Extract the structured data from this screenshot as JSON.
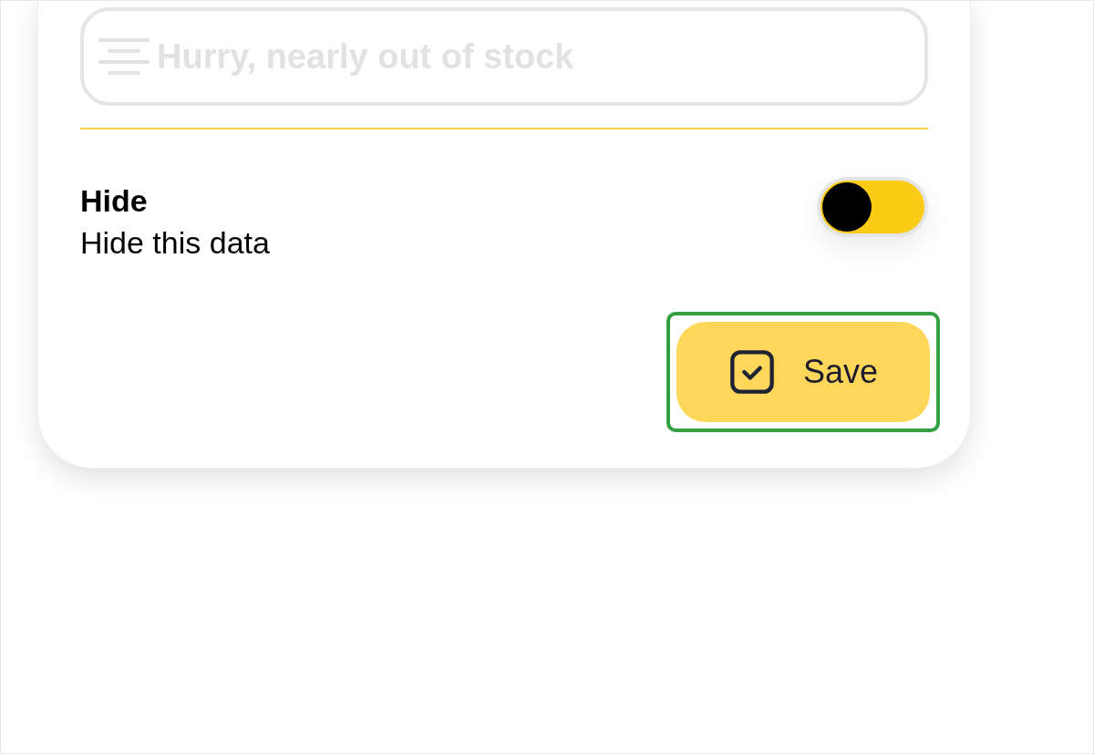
{
  "message_field": {
    "placeholder": "Hurry, nearly out of stock",
    "disabled": true
  },
  "hide_setting": {
    "title": "Hide",
    "description": "Hide this data",
    "on": true
  },
  "save_button": {
    "label": "Save",
    "highlighted": true
  }
}
